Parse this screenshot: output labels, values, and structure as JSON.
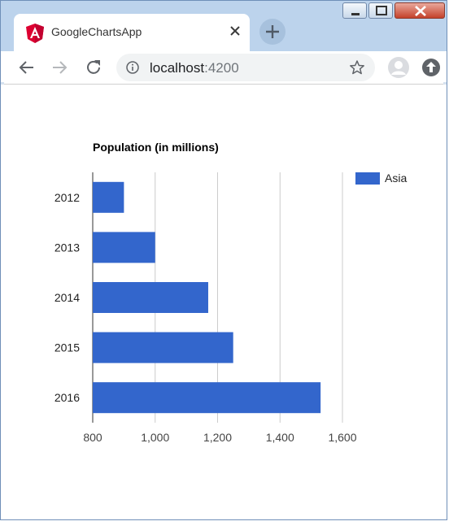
{
  "tab": {
    "title": "GoogleChartsApp"
  },
  "icons": {
    "tab_logo": "angular-logo-icon",
    "tab_close": "close-icon",
    "new_tab": "plus-icon",
    "back": "arrow-left-icon",
    "forward": "arrow-right-icon",
    "reload": "reload-icon",
    "info": "info-icon",
    "bookmark": "star-icon",
    "profile": "profile-icon",
    "update": "update-icon"
  },
  "address_bar": {
    "host": "localhost",
    "port": ":4200"
  },
  "colors": {
    "titlebar": "#bcd3ec",
    "series": "#3366cc",
    "angular_red": "#dd0031",
    "gridline": "#cccccc"
  },
  "chart_data": {
    "type": "bar",
    "orientation": "horizontal",
    "title": "Population (in millions)",
    "categories": [
      "2012",
      "2013",
      "2014",
      "2015",
      "2016"
    ],
    "series": [
      {
        "name": "Asia",
        "values": [
          900,
          1000,
          1170,
          1250,
          1530
        ],
        "color": "#3366cc"
      }
    ],
    "xlim": [
      800,
      1600
    ],
    "x_ticks": [
      800,
      1000,
      1200,
      1400,
      1600
    ],
    "x_tick_labels": [
      "800",
      "1,000",
      "1,200",
      "1,400",
      "1,600"
    ],
    "grid": true,
    "legend_position": "right"
  }
}
